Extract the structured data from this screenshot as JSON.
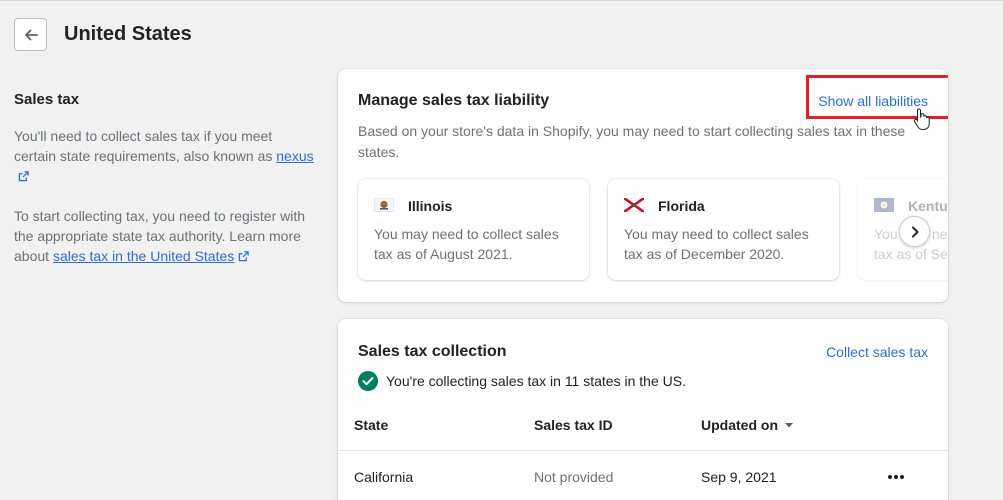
{
  "header": {
    "title": "United States"
  },
  "sales_tax_section": {
    "title": "Sales tax",
    "para1_text": "You'll need to collect sales tax if you meet certain state requirements, also known as",
    "para1_link": "nexus",
    "para2_text": "To start collecting tax, you need to register with the appropriate state tax authority. Learn more about",
    "para2_link": "sales tax in the United States"
  },
  "liability_card": {
    "title": "Manage sales tax liability",
    "action_label": "Show all liabilities",
    "description": "Based on your store's data in Shopify, you may need to start collecting sales tax in these states.",
    "states": [
      {
        "name": "Illinois",
        "desc": "You may need to collect sales tax as of August 2021."
      },
      {
        "name": "Florida",
        "desc": "You may need to collect sales tax as of December 2020."
      },
      {
        "name": "Kentu",
        "desc": "You may need to collect sales tax as of Se"
      }
    ]
  },
  "collection_card": {
    "title": "Sales tax collection",
    "action_label": "Collect sales tax",
    "status": "You're collecting sales tax in 11 states in the US.",
    "columns": [
      "State",
      "Sales tax ID",
      "Updated on"
    ],
    "rows": [
      {
        "state": "California",
        "tax_id": "Not provided",
        "updated": "Sep 9, 2021"
      }
    ]
  },
  "colors": {
    "link": "#2c6ecb",
    "success": "#008060",
    "highlight": "#e0202b"
  }
}
